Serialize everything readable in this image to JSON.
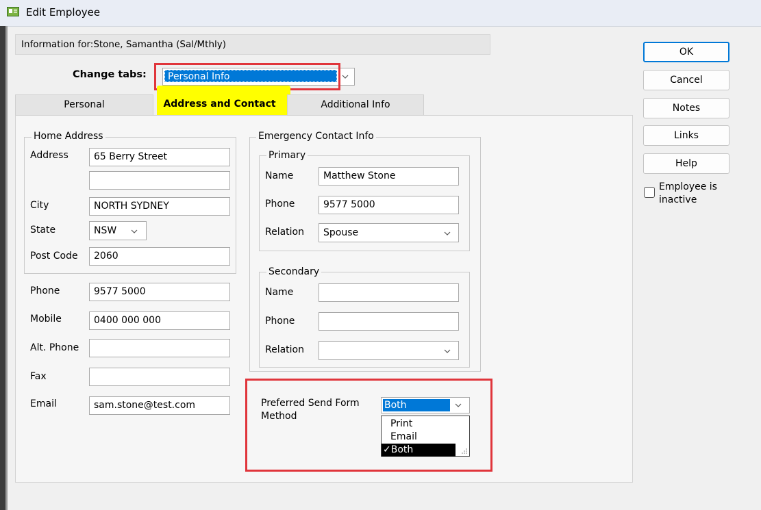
{
  "window": {
    "title": "Edit Employee"
  },
  "info": {
    "label": "Information for:",
    "value": "Stone, Samantha (Sal/Mthly)"
  },
  "change_tabs": {
    "label": "Change tabs:",
    "value": "Personal Info"
  },
  "tabs": [
    {
      "label": "Personal",
      "active": false
    },
    {
      "label": "Address and Contact",
      "active": true
    },
    {
      "label": "Additional Info",
      "active": false
    }
  ],
  "home_address": {
    "title": "Home Address",
    "address_label": "Address",
    "address_line1": "65 Berry Street",
    "address_line2": "",
    "city_label": "City",
    "city": "NORTH SYDNEY",
    "state_label": "State",
    "state": "NSW",
    "postcode_label": "Post Code",
    "postcode": "2060"
  },
  "contact": {
    "phone_label": "Phone",
    "phone": "9577 5000",
    "mobile_label": "Mobile",
    "mobile": "0400 000 000",
    "alt_phone_label": "Alt. Phone",
    "alt_phone": "",
    "fax_label": "Fax",
    "fax": "",
    "email_label": "Email",
    "email": "sam.stone@test.com"
  },
  "emergency": {
    "title": "Emergency Contact Info",
    "primary": {
      "title": "Primary",
      "name_label": "Name",
      "name": "Matthew Stone",
      "phone_label": "Phone",
      "phone": "9577 5000",
      "relation_label": "Relation",
      "relation": "Spouse"
    },
    "secondary": {
      "title": "Secondary",
      "name_label": "Name",
      "name": "",
      "phone_label": "Phone",
      "phone": "",
      "relation_label": "Relation",
      "relation": ""
    }
  },
  "send_method": {
    "label_line1": "Preferred Send Form",
    "label_line2": "Method",
    "value": "Both",
    "options": [
      "Print",
      "Email",
      "Both"
    ],
    "checkmark": "✓"
  },
  "buttons": {
    "ok": "OK",
    "cancel": "Cancel",
    "notes": "Notes",
    "links": "Links",
    "help": "Help"
  },
  "inactive": {
    "label_line1": "Employee is",
    "label_line2": "inactive",
    "checked": false
  },
  "colors": {
    "selection": "#0078d7",
    "annotation_red": "#e0353b",
    "annotation_yellow": "#ffff00"
  }
}
